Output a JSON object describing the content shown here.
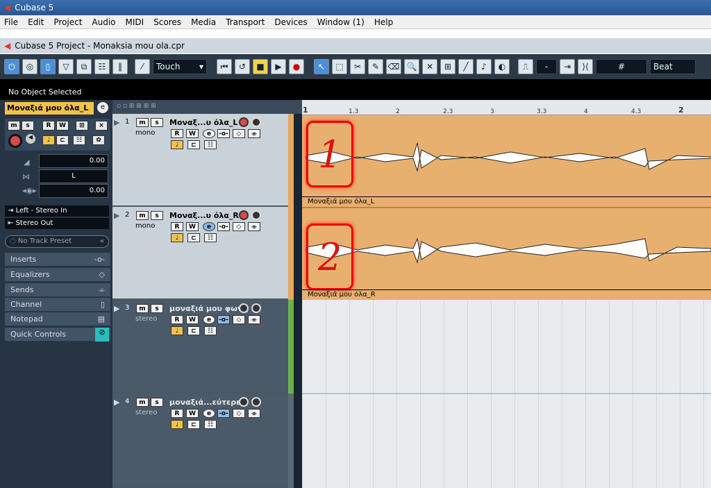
{
  "window": {
    "title": "Cubase 5"
  },
  "menu": [
    "File",
    "Edit",
    "Project",
    "Audio",
    "MIDI",
    "Scores",
    "Media",
    "Transport",
    "Devices",
    "Window (1)",
    "Help"
  ],
  "project": {
    "title": "Cubase 5 Project - Monaksia mou ola.cpr"
  },
  "toolbar": {
    "automation_mode": "Touch",
    "snap_value": "-",
    "grid_value": "Beat"
  },
  "info_line": "No Object Selected",
  "inspector": {
    "track_name": "Μοναξιά μου όλα_L",
    "volume": "0.00",
    "pan": "L",
    "delay": "0.00",
    "input": "Left - Stereo In",
    "output": "Stereo Out",
    "preset": "No Track Preset",
    "sections": [
      "Inserts",
      "Equalizers",
      "Sends",
      "Channel",
      "Notepad",
      "Quick Controls"
    ]
  },
  "ruler": {
    "ticks": [
      "1",
      "1.3",
      "2",
      "2.3",
      "3",
      "3.3",
      "4",
      "4.3",
      "2"
    ]
  },
  "tracks": [
    {
      "number": "1",
      "name": "Μοναξ...υ όλα_L",
      "mode": "mono",
      "event": "Μοναξιά μου όλα_L",
      "marker": "1"
    },
    {
      "number": "2",
      "name": "Μοναξ...υ όλα_R",
      "mode": "mono",
      "event": "Μοναξιά μου όλα_R",
      "marker": "2"
    },
    {
      "number": "3",
      "name": "μοναξιά μου φωνή",
      "mode": "stereo"
    },
    {
      "number": "4",
      "name": "μοναξιά...εύτερες",
      "mode": "stereo"
    }
  ],
  "buttons": {
    "m": "m",
    "s": "s",
    "r": "R",
    "w": "W",
    "e": "e"
  },
  "colors": {
    "event": "#e8b06f",
    "record": "#d94a4a",
    "marker": "#ee0000",
    "accent": "#f0c14d"
  }
}
